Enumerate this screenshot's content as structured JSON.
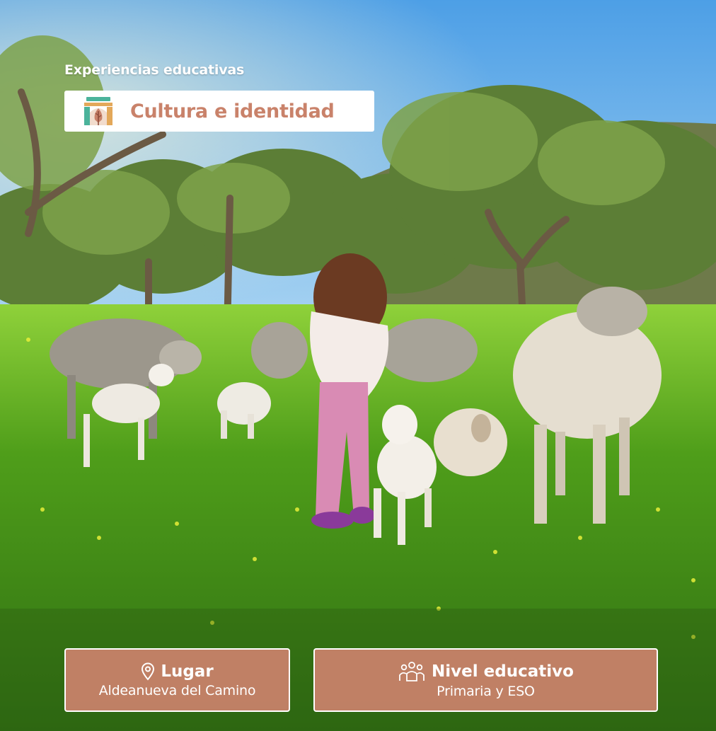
{
  "header": {
    "kicker": "Experiencias educativas",
    "category": {
      "label": "Cultura e identidad",
      "icon": "heritage-building-leaf-icon",
      "color": "#c9826a"
    }
  },
  "info": {
    "place": {
      "icon": "location-pin-icon",
      "label": "Lugar",
      "value": "Aldeanueva del Camino"
    },
    "level": {
      "icon": "group-people-icon",
      "label": "Nivel educativo",
      "value": "Primaria y ESO"
    }
  },
  "colors": {
    "accent": "#c9826a",
    "sky": "#5aa6e6",
    "grass": "#5fae1e"
  }
}
